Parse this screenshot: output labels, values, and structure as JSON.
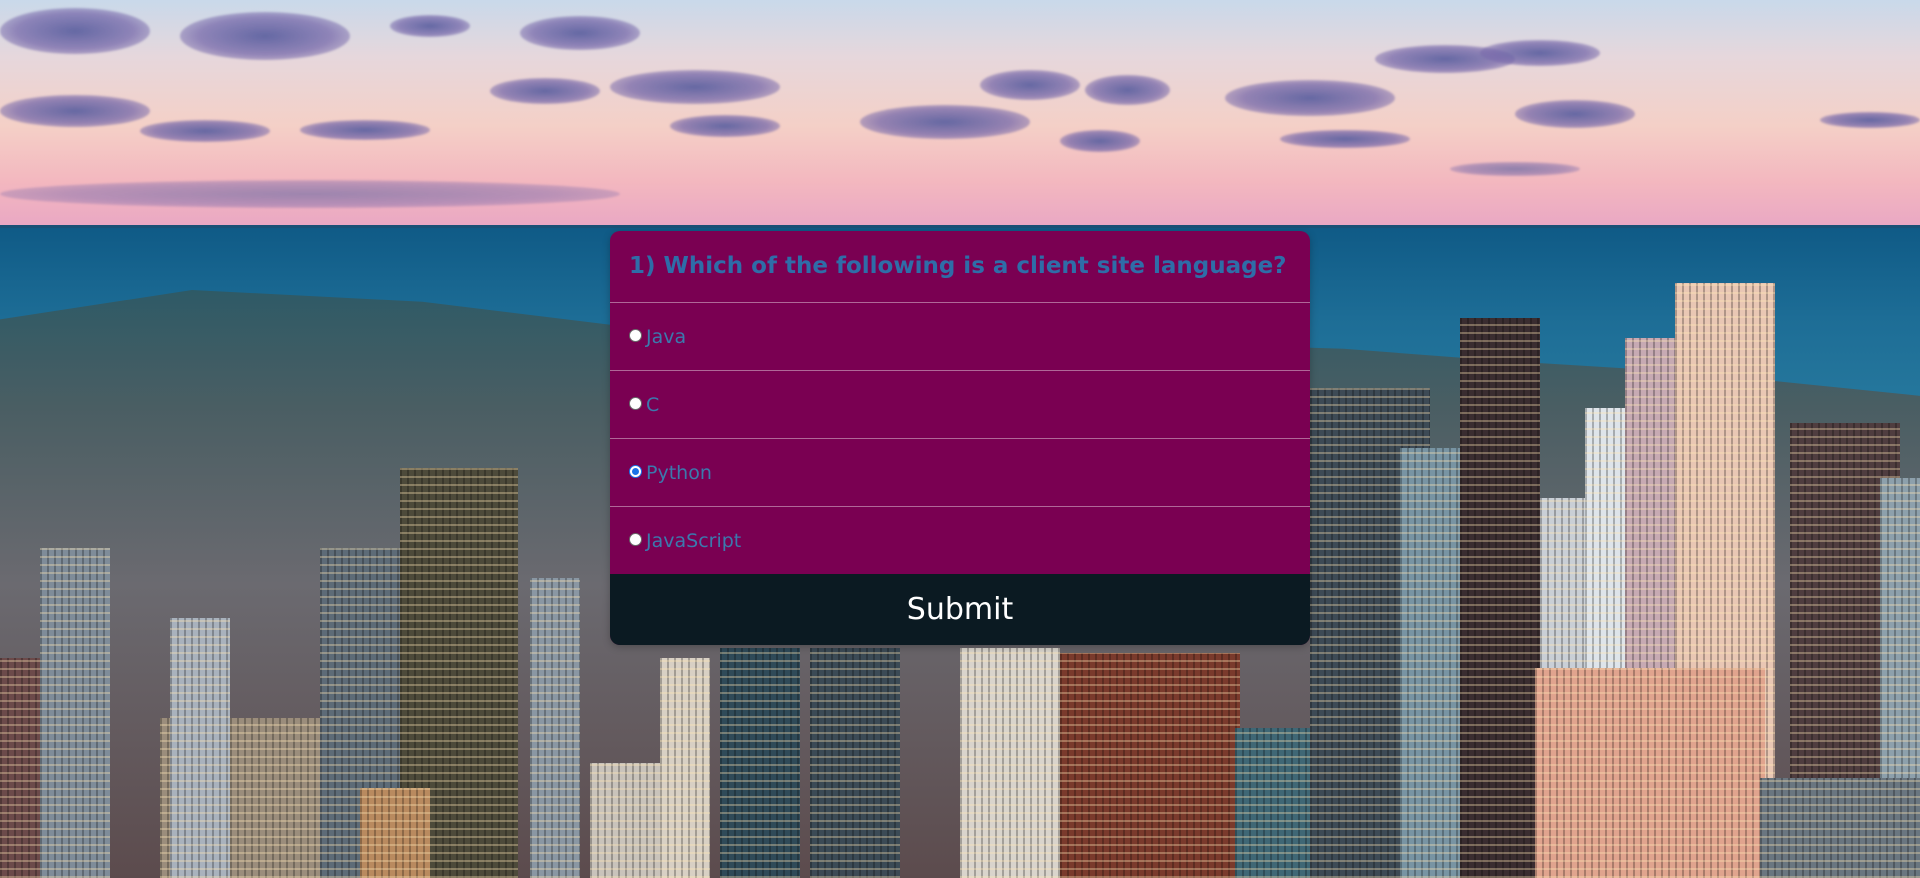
{
  "quiz": {
    "question": "1) Which of the following is a client site language?",
    "options": [
      {
        "label": "Java",
        "selected": false
      },
      {
        "label": "C",
        "selected": false
      },
      {
        "label": "Python",
        "selected": true
      },
      {
        "label": "JavaScript",
        "selected": false
      }
    ],
    "submit_label": "Submit"
  },
  "colors": {
    "card_background": "#7a0052",
    "text_accent": "#3b79ad",
    "submit_background": "#0b1a22"
  }
}
